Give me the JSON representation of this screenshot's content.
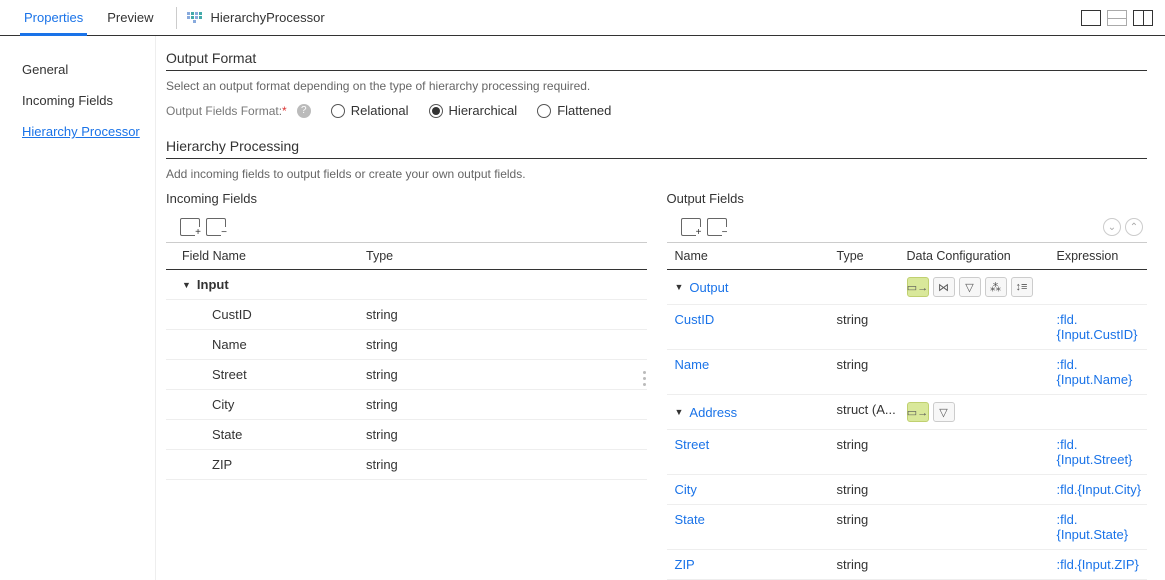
{
  "header": {
    "tabs": [
      "Properties",
      "Preview"
    ],
    "active_tab": "Properties",
    "processor_name": "HierarchyProcessor"
  },
  "sidebar": {
    "items": [
      "General",
      "Incoming Fields",
      "Hierarchy Processor"
    ],
    "active": "Hierarchy Processor"
  },
  "output_format": {
    "title": "Output Format",
    "subtitle": "Select an output format depending on the type of hierarchy processing required.",
    "label": "Output Fields Format:",
    "options": [
      "Relational",
      "Hierarchical",
      "Flattened"
    ],
    "selected": "Hierarchical"
  },
  "hierarchy": {
    "title": "Hierarchy Processing",
    "subtitle": "Add incoming fields to output fields or create your own output fields."
  },
  "incoming": {
    "title": "Incoming Fields",
    "headers": [
      "Field Name",
      "Type"
    ],
    "root": "Input",
    "rows": [
      {
        "name": "CustID",
        "type": "string"
      },
      {
        "name": "Name",
        "type": "string"
      },
      {
        "name": "Street",
        "type": "string"
      },
      {
        "name": "City",
        "type": "string"
      },
      {
        "name": "State",
        "type": "string"
      },
      {
        "name": "ZIP",
        "type": "string"
      }
    ]
  },
  "output": {
    "title": "Output Fields",
    "headers": [
      "Name",
      "Type",
      "Data Configuration",
      "Expression"
    ],
    "root": "Output",
    "rows": [
      {
        "name": "CustID",
        "type": "string",
        "expr": ":fld.{Input.CustID}",
        "indent": 2
      },
      {
        "name": "Name",
        "type": "string",
        "expr": ":fld.{Input.Name}",
        "indent": 2
      },
      {
        "name": "Address",
        "type": "struct (A...",
        "struct": true,
        "indent": 2
      },
      {
        "name": "Street",
        "type": "string",
        "expr": ":fld.{Input.Street}",
        "indent": 3
      },
      {
        "name": "City",
        "type": "string",
        "expr": ":fld.{Input.City}",
        "indent": 3
      },
      {
        "name": "State",
        "type": "string",
        "expr": ":fld.{Input.State}",
        "indent": 3
      },
      {
        "name": "ZIP",
        "type": "string",
        "expr": ":fld.{Input.ZIP}",
        "indent": 3
      }
    ]
  }
}
